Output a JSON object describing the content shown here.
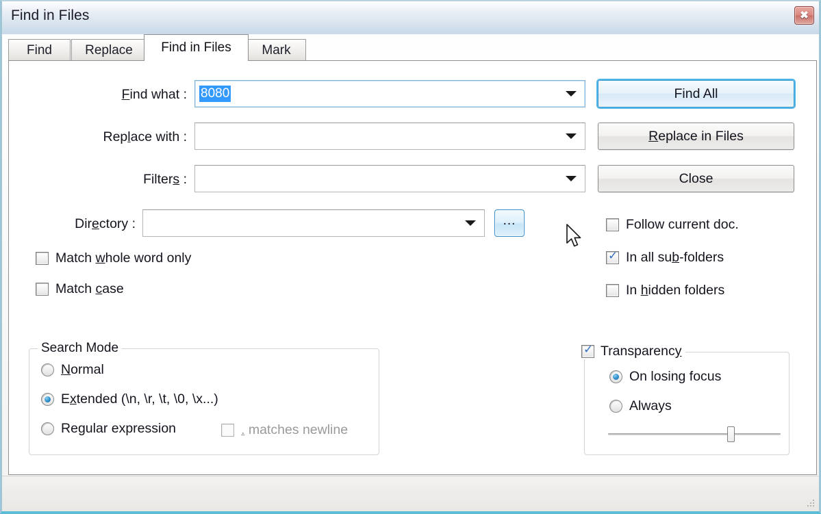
{
  "window": {
    "title": "Find in Files",
    "close_icon": "close-icon",
    "close_glyph": "✖"
  },
  "tabs": [
    {
      "label": "Find",
      "active": false
    },
    {
      "label": "Replace",
      "active": false
    },
    {
      "label": "Find in Files",
      "active": true
    },
    {
      "label": "Mark",
      "active": false
    }
  ],
  "fields": {
    "find_what": {
      "label": "Find what :",
      "value": "8080",
      "placeholder": "",
      "selected": true
    },
    "replace_with": {
      "label": "Replace with :",
      "value": "",
      "placeholder": ""
    },
    "filters": {
      "label": "Filters :",
      "value": "",
      "placeholder": ""
    },
    "directory": {
      "label": "Directory :",
      "value": "",
      "placeholder": "",
      "browse_label": "...",
      "browse_icon": "ellipsis-icon"
    }
  },
  "buttons": {
    "find_all": "Find All",
    "replace_in_files": "Replace in Files",
    "close": "Close"
  },
  "left_options": [
    {
      "label": "Match whole word only",
      "checked": false
    },
    {
      "label": "Match case",
      "checked": false
    }
  ],
  "right_options": [
    {
      "label": "Follow current doc.",
      "checked": false
    },
    {
      "label": "In all sub-folders",
      "checked": true
    },
    {
      "label": "In hidden folders",
      "checked": false
    }
  ],
  "search_mode": {
    "title": "Search Mode",
    "options": [
      {
        "label": "Normal",
        "selected": false
      },
      {
        "label": "Extended (\\n, \\r, \\t, \\0, \\x...)",
        "selected": true
      },
      {
        "label": "Regular expression",
        "selected": false
      }
    ],
    "dot_matches_newline": {
      "label": ". matches newline",
      "checked": false,
      "disabled": true
    }
  },
  "transparency": {
    "title": "Transparency",
    "checked": true,
    "options": [
      {
        "label": "On losing focus",
        "selected": true
      },
      {
        "label": "Always",
        "selected": false
      }
    ],
    "slider_percent": 72
  },
  "colors": {
    "accent_blue": "#3399ff",
    "default_button_glow": "#53b6e8",
    "check_blue": "#2f6fc0",
    "window_border": "#5bbcd6",
    "close_red": "#c96f68"
  },
  "checkmark_glyph": "✓"
}
